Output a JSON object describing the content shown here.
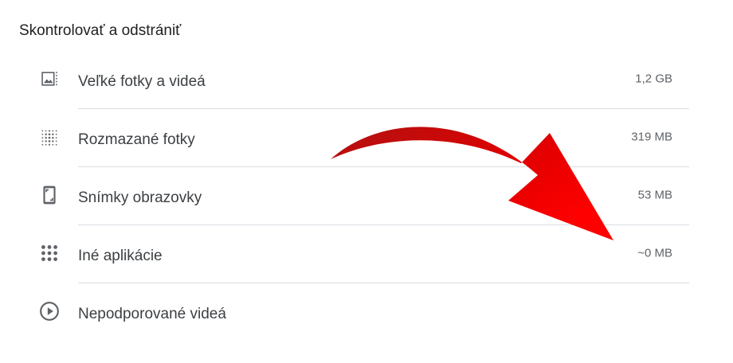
{
  "section": {
    "title": "Skontrolovať a odstrániť"
  },
  "items": [
    {
      "icon": "large-photo-icon",
      "label": "Veľké fotky a videá",
      "size": "1,2 GB"
    },
    {
      "icon": "blurry-photo-icon",
      "label": "Rozmazané fotky",
      "size": "319 MB"
    },
    {
      "icon": "screenshot-icon",
      "label": "Snímky obrazovky",
      "size": "53 MB"
    },
    {
      "icon": "apps-grid-icon",
      "label": "Iné aplikácie",
      "size": "~0 MB"
    },
    {
      "icon": "play-circle-icon",
      "label": "Nepodporované videá"
    }
  ],
  "colors": {
    "icon": "#5f6368",
    "text": "#3c4043",
    "muted": "#5f6368",
    "divider": "#dadce0",
    "arrow": "#e00000"
  }
}
